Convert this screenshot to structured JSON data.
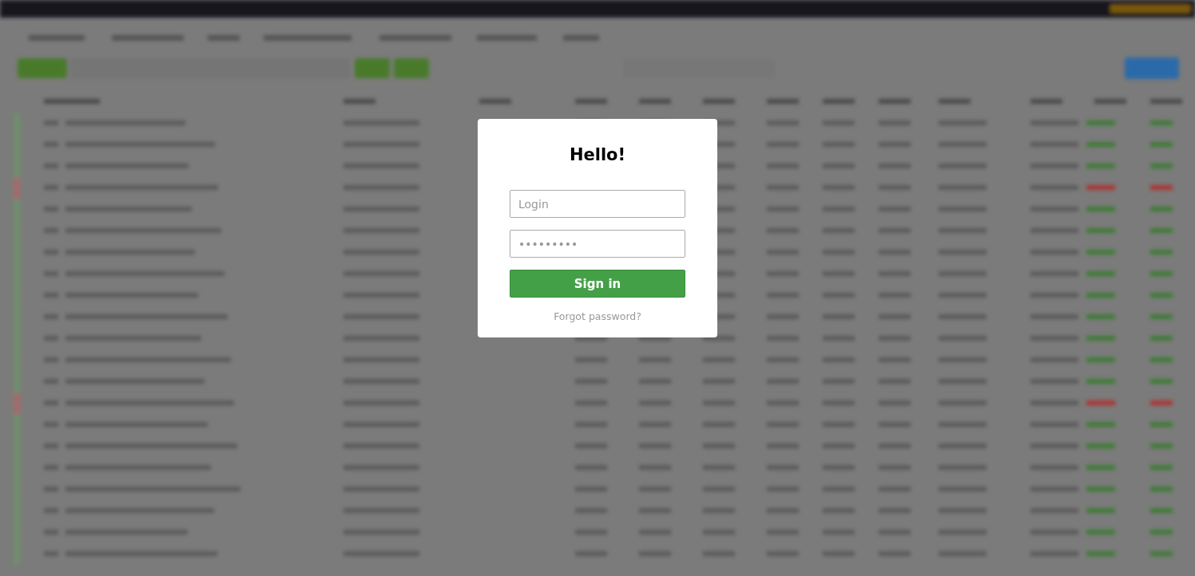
{
  "dialog": {
    "title": "Hello!",
    "login": {
      "placeholder": "Login"
    },
    "password": {
      "placeholder": "•••••••••"
    },
    "button": "Sign in",
    "link": "Forgot password?"
  }
}
